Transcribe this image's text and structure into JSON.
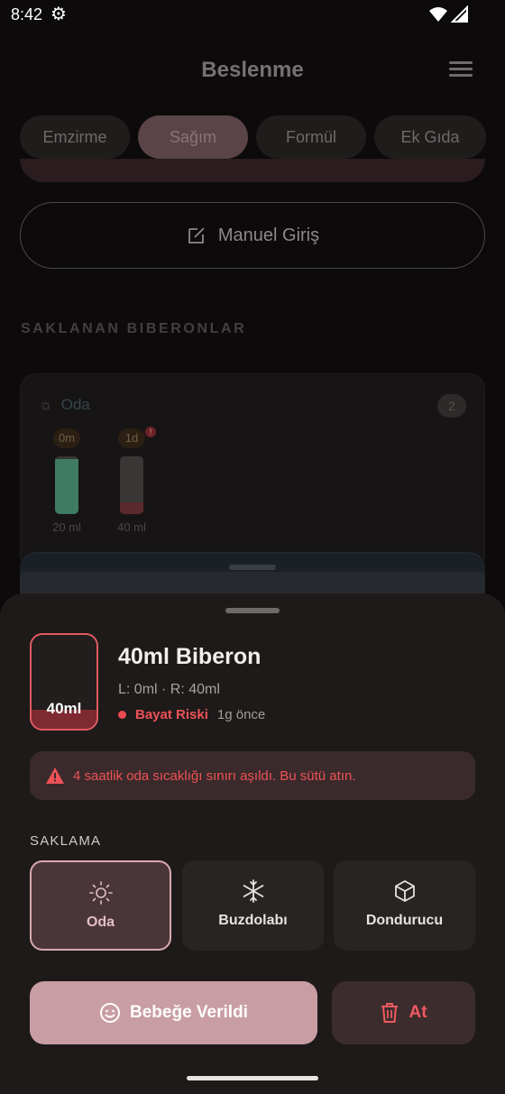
{
  "status_bar": {
    "time": "8:42"
  },
  "header": {
    "title": "Beslenme"
  },
  "tabs": [
    {
      "label": "Emzirme",
      "active": false
    },
    {
      "label": "Sağım",
      "active": true
    },
    {
      "label": "Formül",
      "active": false
    },
    {
      "label": "Ek Gıda",
      "active": false
    }
  ],
  "manual_entry": {
    "label": "Manuel Giriş"
  },
  "stored_section": {
    "label": "SAKLANAN BIBERONLAR"
  },
  "store_card": {
    "name": "Oda",
    "count": "2",
    "bottles": [
      {
        "age": "0m",
        "volume": "20 ml",
        "fill_fraction": 0.95,
        "color": "#3f7a62"
      },
      {
        "age": "1d",
        "volume": "40 ml",
        "fill_fraction": 0.2,
        "color": "#5a2a2e",
        "warning": "!"
      }
    ]
  },
  "sheet": {
    "thumb_label": "40ml",
    "thumb_fill_fraction": 0.2,
    "title": "40ml Biberon",
    "sides": "L: 0ml · R: 40ml",
    "risk_label": "Bayat Riski",
    "ago": "1g önce",
    "alert": "4 saatlik oda sıcaklığı sınırı aşıldı. Bu sütü atın.",
    "storage_label": "SAKLAMA",
    "storage_options": [
      {
        "label": "Oda",
        "icon": "sun-icon",
        "selected": true
      },
      {
        "label": "Buzdolabı",
        "icon": "snowflake-icon",
        "selected": false
      },
      {
        "label": "Dondurucu",
        "icon": "cube-icon",
        "selected": false
      }
    ],
    "given_button": "Bebeğe Verildi",
    "discard_button": "At"
  },
  "colors": {
    "accent": "#c99da4",
    "danger": "#ee5257"
  }
}
